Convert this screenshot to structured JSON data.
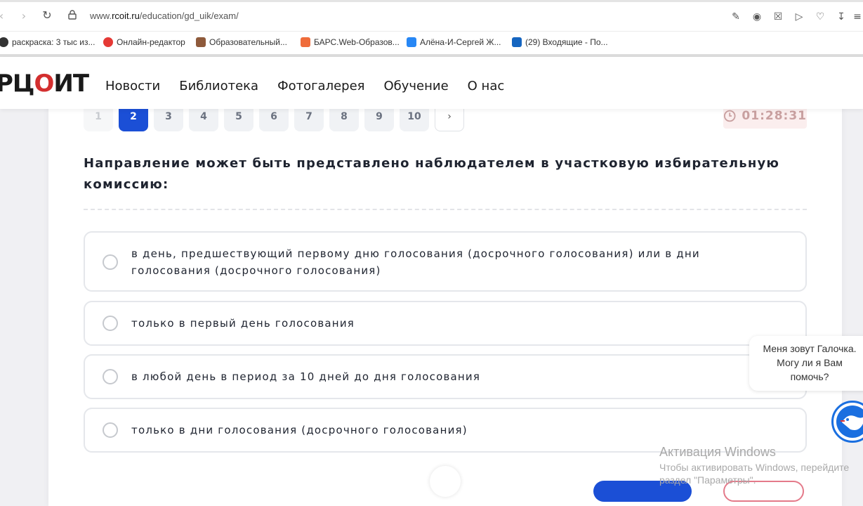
{
  "browser": {
    "url_prefix": "www.",
    "url_domain": "rcoit.ru",
    "url_path": "/education/gd_uik/exam/",
    "bookmarks": [
      {
        "label": "раскраска: 3 тыс из...",
        "color": "#333333"
      },
      {
        "label": "Онлайн-редактор",
        "color": "#e53935"
      },
      {
        "label": "Образовательный...",
        "color": "#8e5a3b"
      },
      {
        "label": "БАРС.Web-Образов...",
        "color": "#ef6c3b"
      },
      {
        "label": "Алёна-И-Сергей Ж...",
        "color": "#2787f5"
      },
      {
        "label": "(29) Входящие - По...",
        "color": "#1565c0"
      }
    ]
  },
  "site": {
    "logo_left": "РЦ",
    "logo_check": "О",
    "logo_right": "ИТ",
    "menu": [
      "Новости",
      "Библиотека",
      "Фотогалерея",
      "Обучение",
      "О нас"
    ]
  },
  "exam": {
    "pages": [
      "1",
      "2",
      "3",
      "4",
      "5",
      "6",
      "7",
      "8",
      "9",
      "10"
    ],
    "active_page": "2",
    "next_label": "›",
    "timer": "01:28:31",
    "question": "Направление может быть представлено наблюдателем в участковую избирательную комиссию:",
    "options": [
      "в день, предшествующий первому дню голосования (досрочного голосования) или в дни голосования (досрочного голосования)",
      "только в первый день голосования",
      "в любой день в период за 10 дней до дня голосования",
      "только в дни голосования (досрочного голосования)"
    ]
  },
  "chat": {
    "line1": "Меня зовут Галочка.",
    "line2": "Могу ли я Вам",
    "line3": "помочь?"
  },
  "windows": {
    "title": "Активация Windows",
    "line1": "Чтобы активировать Windows, перейдите",
    "line2": "раздел \"Параметры\"."
  },
  "colors": {
    "accent": "#1b4fd6",
    "timer_bg": "#fbeeee",
    "logo_check": "#d32f2f"
  }
}
